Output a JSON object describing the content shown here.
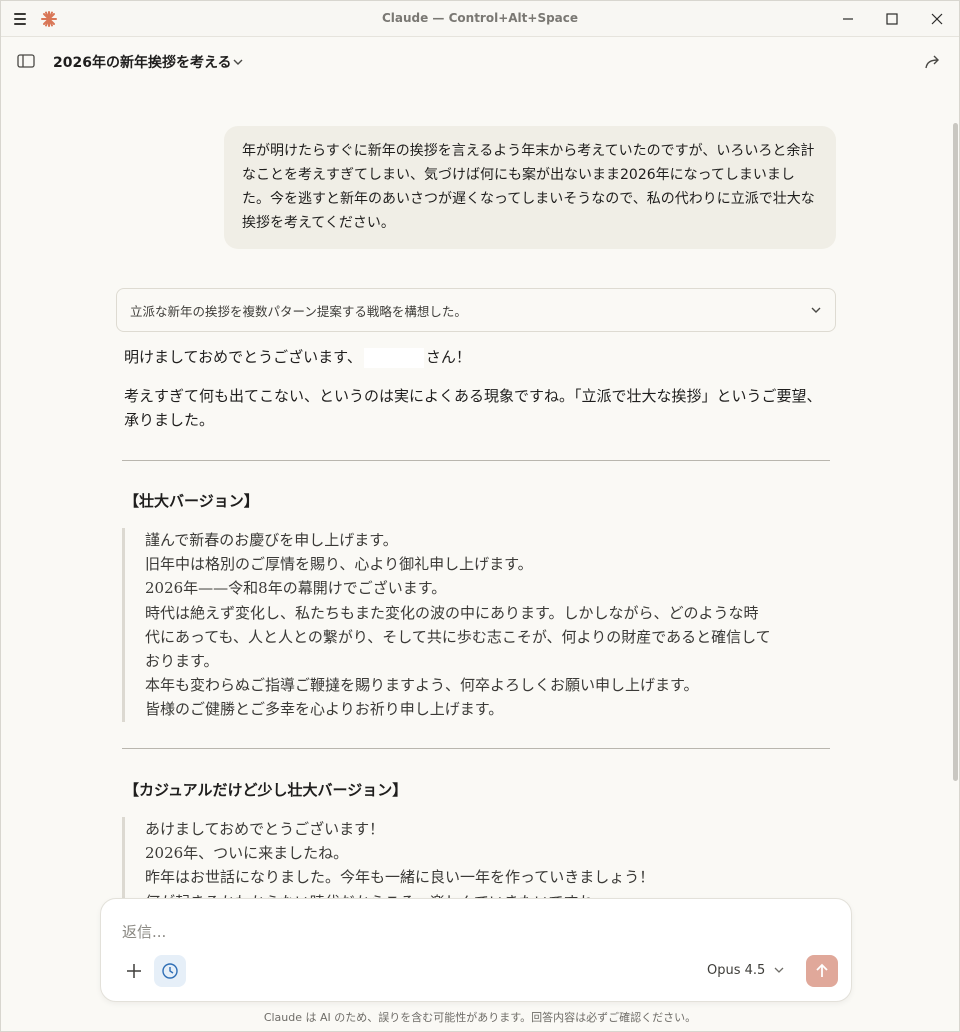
{
  "window": {
    "title": "Claude — Control+Alt+Space"
  },
  "header": {
    "conversation_title": "2026年の新年挨拶を考える"
  },
  "user_message": "年が明けたらすぐに新年の挨拶を言えるよう年末から考えていたのですが、いろいろと余計なことを考えすぎてしまい、気づけば何にも案が出ないまま2026年になってしまいました。今を逃すと新年のあいさつが遅くなってしまいそうなので、私の代わりに立派で壮大な挨拶を考えてください。",
  "thinking": {
    "summary": "立派な新年の挨拶を複数パターン提案する戦略を構想した。"
  },
  "response": {
    "greeting_before": "明けましておめでとうございます、",
    "greeting_after": "さん！",
    "intro": "考えすぎて何も出てこない、というのは実によくある現象ですね。「立派で壮大な挨拶」というご要望、承りました。",
    "section1_title": "【壮大バージョン】",
    "section1_lines": [
      "謹んで新春のお慶びを申し上げます。",
      "旧年中は格別のご厚情を賜り、心より御礼申し上げます。",
      "2026年——令和8年の幕開けでございます。",
      "時代は絶えず変化し、私たちもまた変化の波の中にあります。しかしながら、どのような時代にあっても、人と人との繋がり、そして共に歩む志こそが、何よりの財産であると確信しております。",
      "本年も変わらぬご指導ご鞭撻を賜りますよう、何卒よろしくお願い申し上げます。",
      "皆様のご健勝とご多幸を心よりお祈り申し上げます。"
    ],
    "section2_title": "【カジュアルだけど少し壮大バージョン】",
    "section2_lines": [
      "あけましておめでとうございます！",
      "2026年、ついに来ましたね。",
      "昨年はお世話になりました。今年も一緒に良い一年を作っていきましょう！",
      "何が起きるかわからない時代だからこそ、楽しんでいきたいですね。"
    ]
  },
  "composer": {
    "placeholder": "返信...",
    "model": "Opus 4.5"
  },
  "footer": {
    "disclaimer": "Claude は AI のため、誤りを含む可能性があります。回答内容は必ずご確認ください。"
  },
  "colors": {
    "accent": "#d97757",
    "send_button": "#e0a89a",
    "user_bubble": "#f0eee6",
    "background": "#faf9f5"
  },
  "icons": [
    "menu-icon",
    "claude-logo-icon",
    "minimize-icon",
    "maximize-icon",
    "close-icon",
    "sidebar-toggle-icon",
    "chevron-down-icon",
    "share-icon",
    "plus-icon",
    "history-icon",
    "send-arrow-icon"
  ]
}
